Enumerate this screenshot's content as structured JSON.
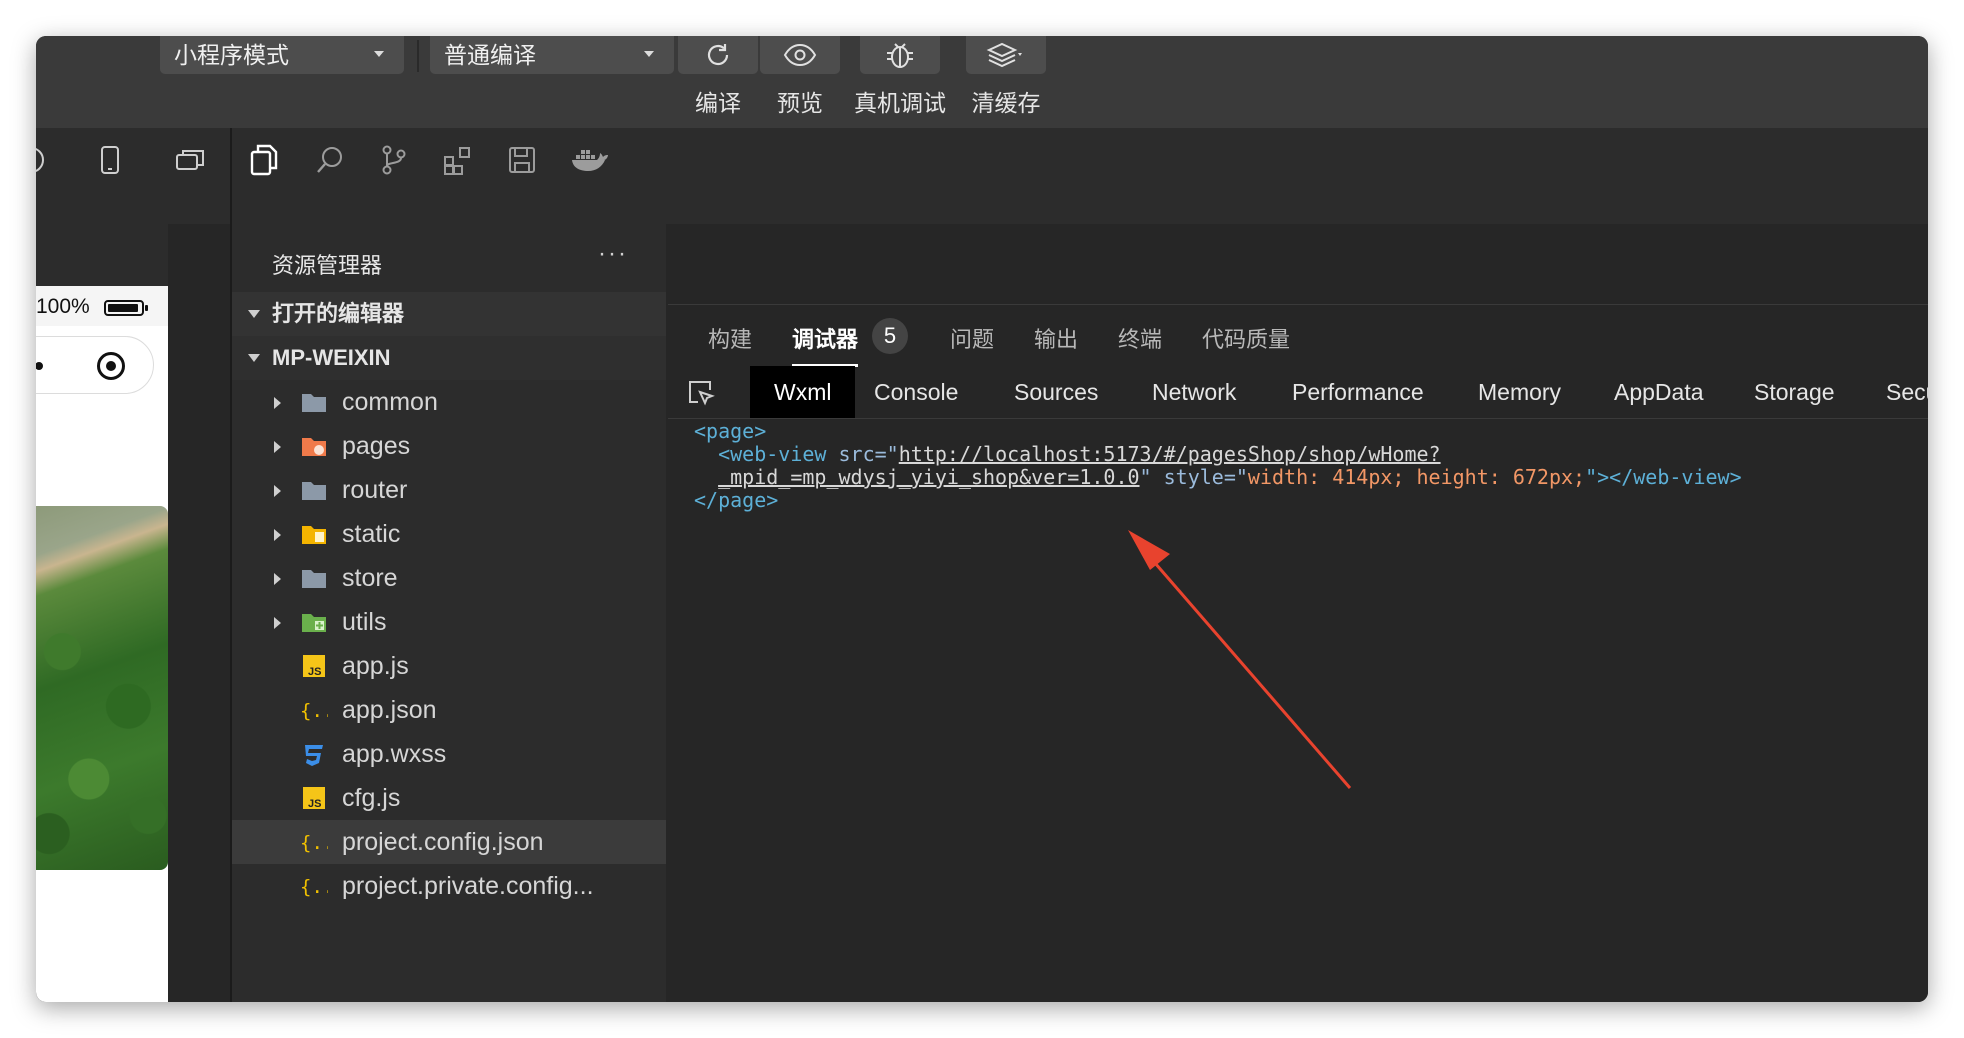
{
  "toolbar": {
    "mode_select": "小程序模式",
    "compile_select": "普通编译",
    "labels": {
      "compile": "编译",
      "preview": "预览",
      "remote_debug": "真机调试",
      "clear_cache": "清缓存"
    }
  },
  "simulator": {
    "battery_pct": "100%"
  },
  "explorer": {
    "title": "资源管理器",
    "more": "···",
    "open_editors": "打开的编辑器",
    "project": "MP-WEIXIN",
    "items": [
      {
        "name": "common",
        "type": "folder"
      },
      {
        "name": "pages",
        "type": "folder"
      },
      {
        "name": "router",
        "type": "folder"
      },
      {
        "name": "static",
        "type": "folder"
      },
      {
        "name": "store",
        "type": "folder"
      },
      {
        "name": "utils",
        "type": "folder"
      },
      {
        "name": "app.js",
        "type": "js"
      },
      {
        "name": "app.json",
        "type": "json"
      },
      {
        "name": "app.wxss",
        "type": "css"
      },
      {
        "name": "cfg.js",
        "type": "js"
      },
      {
        "name": "project.config.json",
        "type": "json"
      },
      {
        "name": "project.private.config...",
        "type": "json"
      }
    ]
  },
  "devtools": {
    "panel_tabs": [
      "构建",
      "调试器",
      "问题",
      "输出",
      "终端",
      "代码质量"
    ],
    "debugger_badge": "5",
    "inner_tabs": [
      "Wxml",
      "Console",
      "Sources",
      "Network",
      "Performance",
      "Memory",
      "AppData",
      "Storage",
      "Securit"
    ],
    "code": {
      "page_open": "<page>",
      "webview_open": "<web-view ",
      "src_attr": "src=\"",
      "url_line1": "http://localhost:5173/#/pagesShop/shop/wHome?",
      "url_line2": "_mpid_=mp_wdysj_yiyi_shop&ver=1.0.0",
      "quote_end": "\" ",
      "style_attr": "style=\"",
      "style_val": "width: 414px; height: 672px;",
      "webview_close": "\"></web-view>",
      "page_close": "</page>"
    }
  },
  "colors": {
    "accent_arrow": "#e8432e",
    "tag": "#5db0d7",
    "value": "#f29766"
  }
}
